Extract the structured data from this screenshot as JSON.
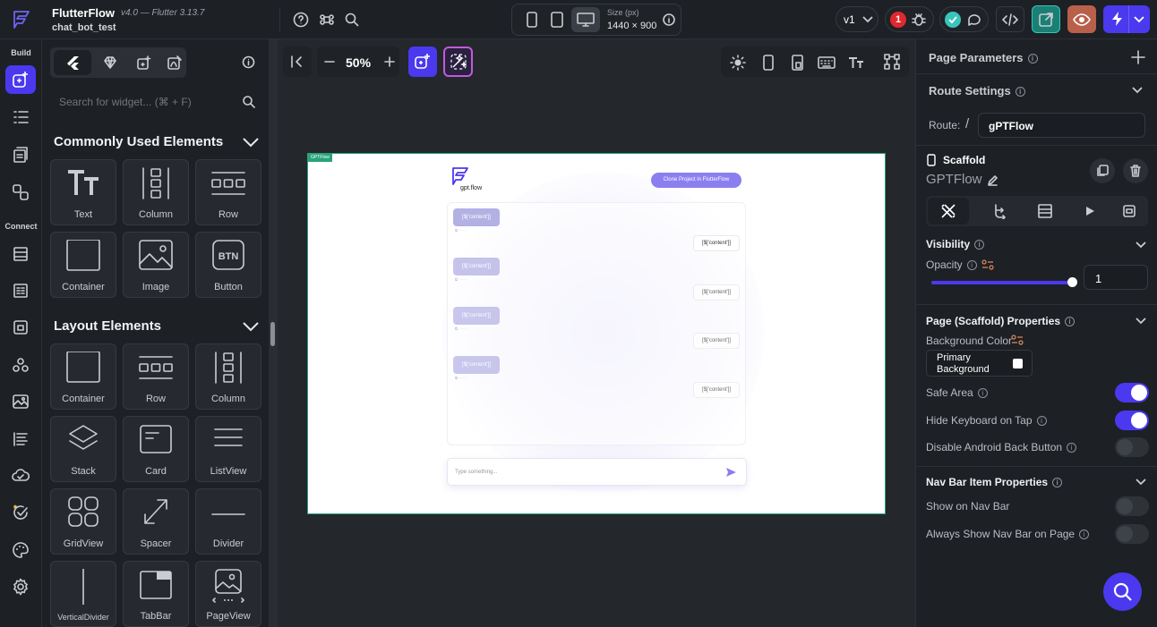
{
  "app": {
    "name": "FlutterFlow",
    "version": "v4.0 — Flutter 3.13.7",
    "project": "chat_bot_test",
    "size_label": "Size (px)",
    "size_value": "1440 × 900",
    "branch": "v1",
    "error_count": "1"
  },
  "rail": {
    "build_label": "Build",
    "connect_label": "Connect"
  },
  "left": {
    "search_placeholder": "Search for widget... (⌘ + F)",
    "common_title": "Commonly Used Elements",
    "common": [
      "Text",
      "Column",
      "Row",
      "Container",
      "Image",
      "Button"
    ],
    "layout_title": "Layout Elements",
    "layout": [
      "Container",
      "Row",
      "Column",
      "Stack",
      "Card",
      "ListView",
      "GridView",
      "Spacer",
      "Divider",
      "VerticalDivider",
      "TabBar",
      "PageView"
    ],
    "button_glyph": "BTN"
  },
  "canvas": {
    "zoom": "50%",
    "page_tag": "GPTFlow",
    "logo_text": "gpt.flow",
    "clone_button": "Clone Project in FlutterFlow",
    "content_label": "[$['content']]",
    "input_placeholder": "Type something..."
  },
  "right": {
    "page_parameters": "Page Parameters",
    "route_settings": "Route Settings",
    "route_label": "Route:",
    "route_slash": "/",
    "route_value": "gPTFlow",
    "scaffold": "Scaffold",
    "page_name": "GPTFlow",
    "visibility": "Visibility",
    "opacity": "Opacity",
    "opacity_value": "1",
    "opacity_level": 1.0,
    "page_props": "Page (Scaffold) Properties",
    "bg_color_label": "Background Color",
    "bg_color_value": "Primary Background",
    "safe_area": "Safe Area",
    "hide_keyboard": "Hide Keyboard on Tap",
    "disable_back": "Disable Android Back Button",
    "navbar_props": "Nav Bar Item Properties",
    "show_navbar": "Show on Nav Bar",
    "always_navbar": "Always Show Nav Bar on Page"
  },
  "colors": {
    "accent": "#4b39ef",
    "teal": "#39c5bb",
    "error": "#e0282e",
    "preview_bg": "#b8604a"
  }
}
